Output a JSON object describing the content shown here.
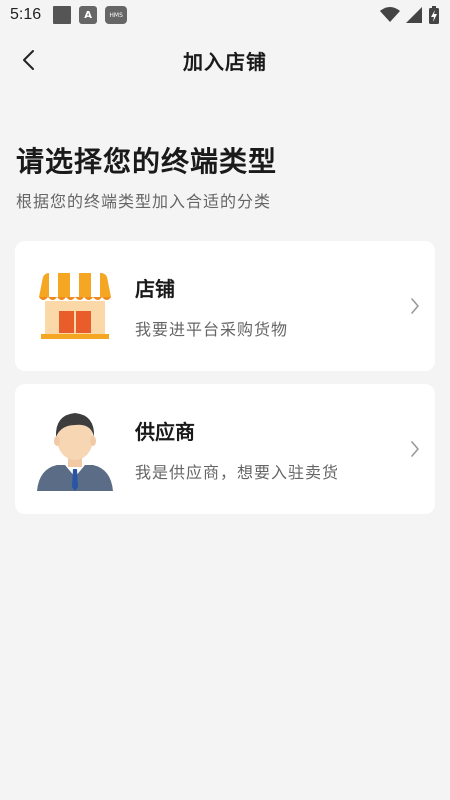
{
  "status_bar": {
    "time": "5:16",
    "icons": [
      "notification-square",
      "a-icon",
      "hms-icon"
    ],
    "hms_label": "HMS",
    "a_label": "A"
  },
  "nav": {
    "title": "加入店铺"
  },
  "heading": "请选择您的终端类型",
  "subheading": "根据您的终端类型加入合适的分类",
  "options": [
    {
      "title": "店铺",
      "description": "我要进平台采购货物",
      "icon": "store-icon"
    },
    {
      "title": "供应商",
      "description": "我是供应商，想要入驻卖货",
      "icon": "supplier-avatar-icon"
    }
  ],
  "colors": {
    "background": "#f4f4f4",
    "card": "#ffffff",
    "store_orange": "#f5a623",
    "store_red": "#e85d2a"
  }
}
